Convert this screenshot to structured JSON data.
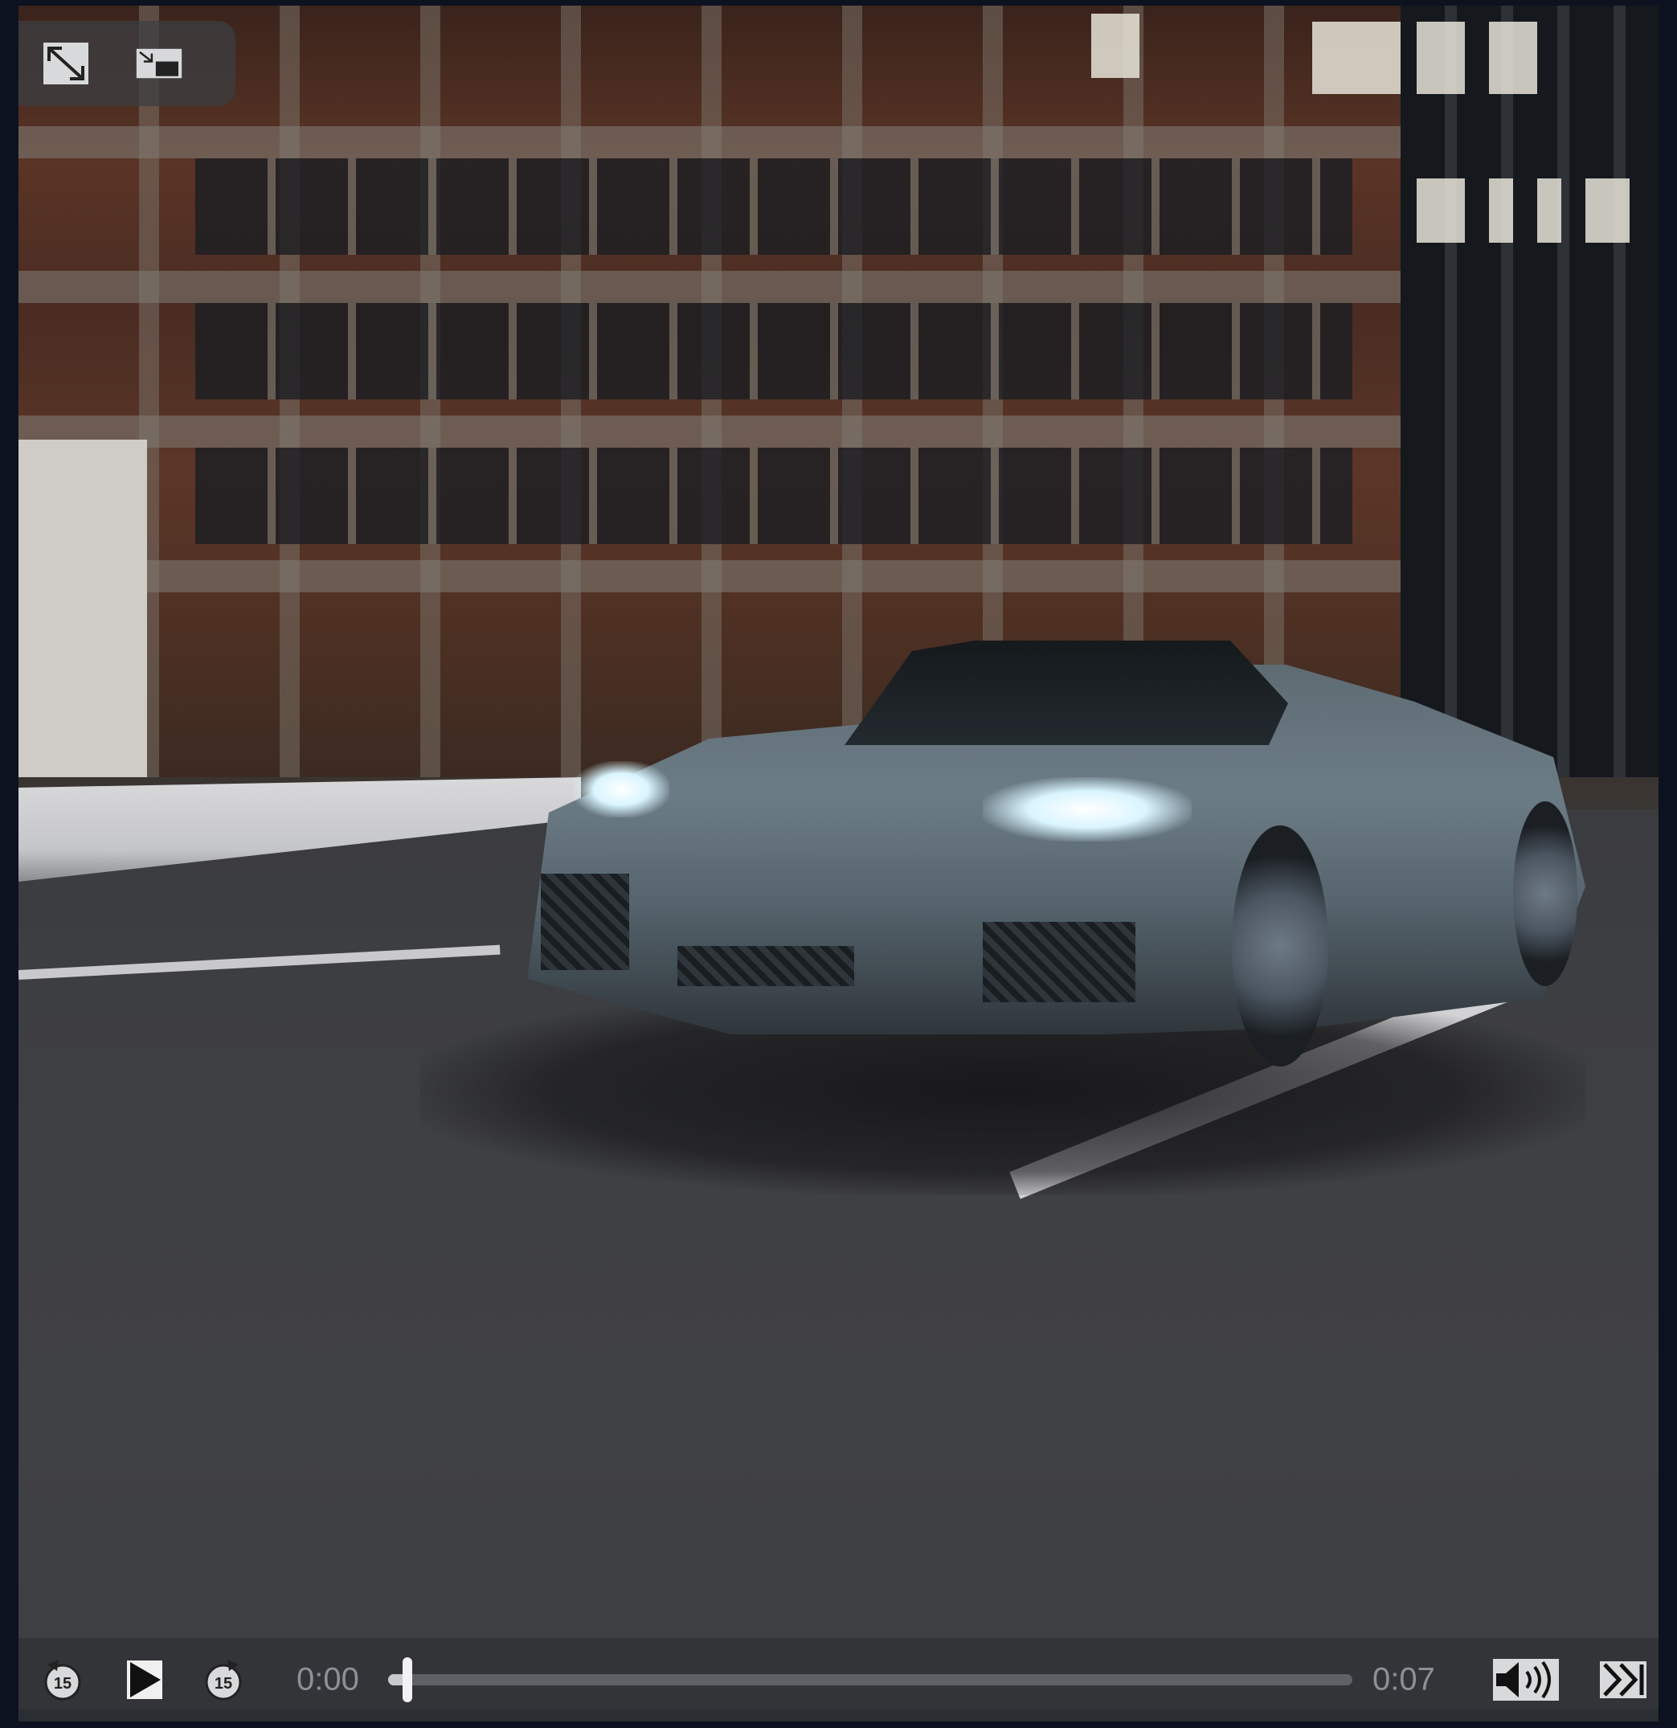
{
  "player": {
    "current_time": "0:00",
    "duration": "0:07",
    "progress": 0.02
  },
  "icons": {
    "fullscreen": "expand-arrows-icon",
    "picture_in_picture": "picture-in-picture-icon",
    "rewind": "rewind-15-icon",
    "play": "play-icon",
    "forward": "forward-15-icon",
    "volume": "volume-icon",
    "skip": "skip-forward-icon"
  },
  "skip_seconds": "15",
  "colors": {
    "overlay_bg": "#303236",
    "icon_fill": "#f2f2f2",
    "time_text": "#8d9096",
    "track": "#5f6166",
    "track_fill": "#c8c9cc"
  }
}
